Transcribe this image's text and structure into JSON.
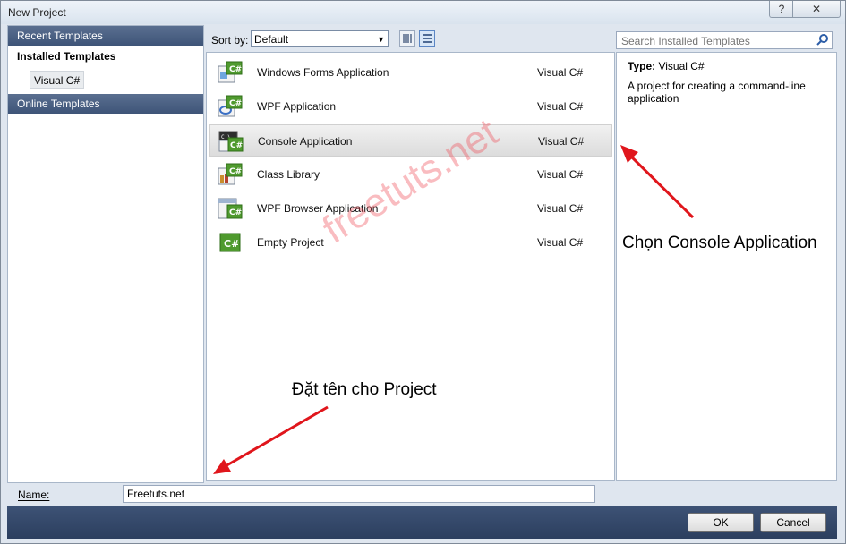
{
  "window": {
    "title": "New Project",
    "help_glyph": "?",
    "close_glyph": "✕"
  },
  "sidebar": {
    "recent": "Recent Templates",
    "installed": "Installed Templates",
    "visual_csharp": "Visual C#",
    "online": "Online Templates"
  },
  "toolbar": {
    "sort_label": "Sort by:",
    "sort_value": "Default"
  },
  "search": {
    "placeholder": "Search Installed Templates"
  },
  "templates": [
    {
      "name": "Windows Forms Application",
      "lang": "Visual C#"
    },
    {
      "name": "WPF Application",
      "lang": "Visual C#"
    },
    {
      "name": "Console Application",
      "lang": "Visual C#"
    },
    {
      "name": "Class Library",
      "lang": "Visual C#"
    },
    {
      "name": "WPF Browser Application",
      "lang": "Visual C#"
    },
    {
      "name": "Empty Project",
      "lang": "Visual C#"
    }
  ],
  "selected_template": "Console Application",
  "details": {
    "type_label": "Type:",
    "type_value": "Visual C#",
    "description": "A project for creating a command-line application"
  },
  "name_field": {
    "label": "Name:",
    "value": "Freetuts.net"
  },
  "buttons": {
    "ok": "OK",
    "cancel": "Cancel"
  },
  "watermark": "freetuts.net",
  "annotations": {
    "console": "Chọn Console Application",
    "name": "Đặt tên cho Project"
  },
  "colors": {
    "nav_header": "#3e5478",
    "footer": "#2c3f5f",
    "arrow": "#e0161c",
    "watermark": "#f0505a"
  }
}
